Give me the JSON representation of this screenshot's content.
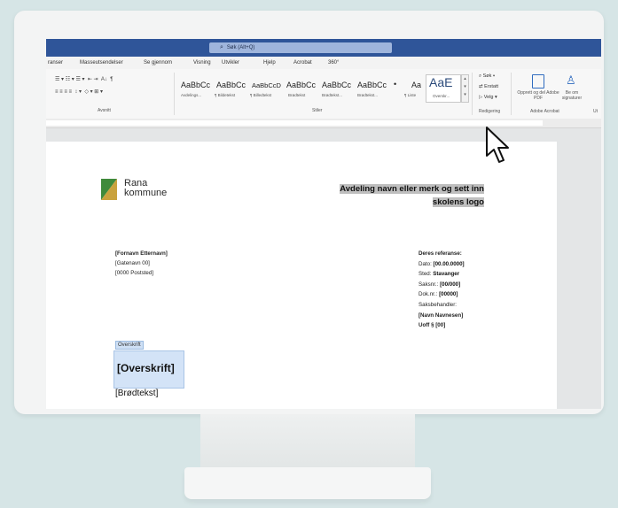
{
  "titlebar": {
    "search": "Søk (Alt+Q)"
  },
  "menu": [
    "ranser",
    "Masseutsendelser",
    "Se gjennom",
    "Visning",
    "Utvikler",
    "Hjelp",
    "Acrobat",
    "360°"
  ],
  "ribbon": {
    "groups": {
      "avsnitt": "Avsnitt",
      "stiler": "Stiler",
      "redigering": "Redigering",
      "adobe": "Adobe Acrobat",
      "ut": "Ut"
    },
    "styles": [
      {
        "sample": "AaBbCc",
        "name": "Avdelings..."
      },
      {
        "sample": "AaBbCc",
        "name": "¶ Bildetekst"
      },
      {
        "sample": "AaBbCcD",
        "name": "¶ Billedtekst"
      },
      {
        "sample": "AaBbCc",
        "name": "Brødtekst"
      },
      {
        "sample": "AaBbCc",
        "name": "Brødtekst..."
      },
      {
        "sample": "AaBbCc",
        "name": "Brødtekst..."
      },
      {
        "sample": "Aa",
        "name": "¶ Liste"
      },
      {
        "sample": "AaE",
        "name": "Overskr..."
      }
    ],
    "editing": {
      "search": "Søk",
      "replace": "Erstatt",
      "select": "Velg"
    },
    "adobe": {
      "create_pdf": "Opprett og del Adobe PDF",
      "signatures": "Be om signaturer"
    }
  },
  "document": {
    "logo": {
      "line1": "Rana",
      "line2": "kommune"
    },
    "header_placeholder_1": "Avdeling navn eller merk og sett inn",
    "header_placeholder_2": "skolens logo",
    "address": [
      "[Fornavn Etternavn]",
      "[Gatenavn 00]",
      "[0000 Poststed]"
    ],
    "reference": {
      "title": "Deres referanse:",
      "date_label": "Dato:",
      "date_value": "[00.00.0000]",
      "place_label": "Sted:",
      "place_value": "Stavanger",
      "case_label": "Saksnr.:",
      "case_value": "[00/000]",
      "doc_label": "Dok.nr.:",
      "doc_value": "[00000]",
      "handler_label": "Saksbehandler:",
      "handler_value": "[Navn Navnesen]",
      "law": "Uoff § [00]"
    },
    "style_tag": "Overskrift",
    "heading": "[Overskrift]",
    "body": "[Brødtekst]"
  },
  "colors": {
    "titlebar": "#2f5599",
    "background": "#d6e5e6",
    "logo_green": "#3f8a3b",
    "logo_gold": "#c9a23d"
  }
}
